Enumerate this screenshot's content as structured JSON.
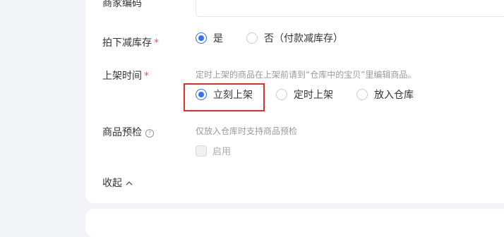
{
  "form": {
    "merchant_code": {
      "label": "商家编码"
    },
    "reduce_stock": {
      "label": "拍下减库存",
      "required_mark": "*",
      "options": [
        {
          "label": "是",
          "checked": true
        },
        {
          "label": "否（付款减库存）",
          "checked": false
        }
      ]
    },
    "listing_time": {
      "label": "上架时间",
      "required_mark": "*",
      "hint": "定时上架的商品在上架前请到“仓库中的宝贝”里编辑商品。",
      "options": [
        {
          "label": "立刻上架",
          "checked": true
        },
        {
          "label": "定时上架",
          "checked": false
        },
        {
          "label": "放入仓库",
          "checked": false
        }
      ]
    },
    "precheck": {
      "label": "商品预检",
      "help_icon": "?",
      "hint": "仅放入仓库时支持商品预检",
      "checkbox_label": "启用",
      "checkbox_disabled": true
    },
    "collapse_label": "收起"
  },
  "colors": {
    "accent": "#3370ff",
    "highlight": "#e0302b",
    "required": "#ff4d4f"
  },
  "icons": {
    "collapse": "chevron-up-icon",
    "help": "question-circle-icon"
  }
}
